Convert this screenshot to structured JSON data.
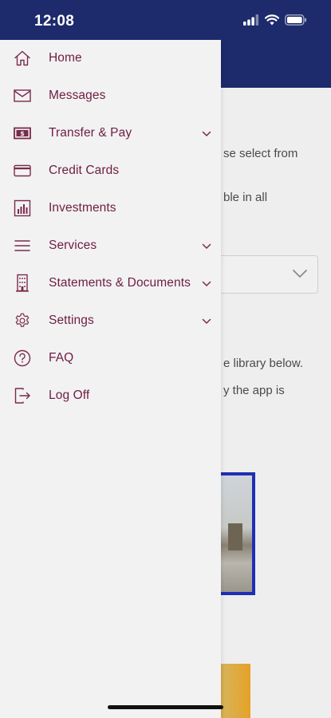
{
  "status_bar": {
    "time": "12:08"
  },
  "background": {
    "line1": "se select from",
    "line2": "ble in all",
    "line3": "e library below.",
    "line4": "y the app is"
  },
  "menu": {
    "items": [
      {
        "label": "Home",
        "icon": "home-icon"
      },
      {
        "label": "Messages",
        "icon": "envelope-icon"
      },
      {
        "label": "Transfer & Pay",
        "icon": "money-icon",
        "expandable": true
      },
      {
        "label": "Credit Cards",
        "icon": "credit-card-icon"
      },
      {
        "label": "Investments",
        "icon": "bar-chart-icon"
      },
      {
        "label": "Services",
        "icon": "menu-lines-icon",
        "expandable": true
      },
      {
        "label": "Statements & Documents",
        "icon": "building-icon",
        "expandable": true
      },
      {
        "label": "Settings",
        "icon": "gear-icon",
        "expandable": true
      },
      {
        "label": "FAQ",
        "icon": "question-icon"
      },
      {
        "label": "Log Off",
        "icon": "logout-icon"
      }
    ]
  },
  "colors": {
    "accent": "#6f1d3f",
    "header": "#1d2a6b",
    "drawer": "#f2f2f3"
  }
}
